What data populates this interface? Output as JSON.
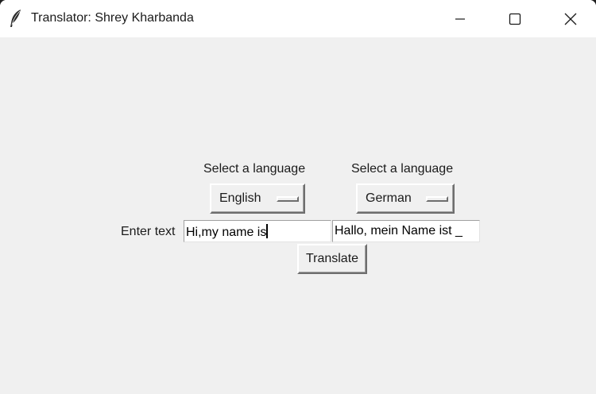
{
  "window": {
    "title": "Translator: Shrey Kharbanda",
    "icon": "feather-icon"
  },
  "source": {
    "select_label": "Select a language",
    "language": "English",
    "entry_label": "Enter text",
    "text": "Hi,my name is"
  },
  "target": {
    "select_label": "Select a language",
    "language": "German",
    "text": "Hallo, mein Name ist _"
  },
  "actions": {
    "translate_label": "Translate"
  }
}
